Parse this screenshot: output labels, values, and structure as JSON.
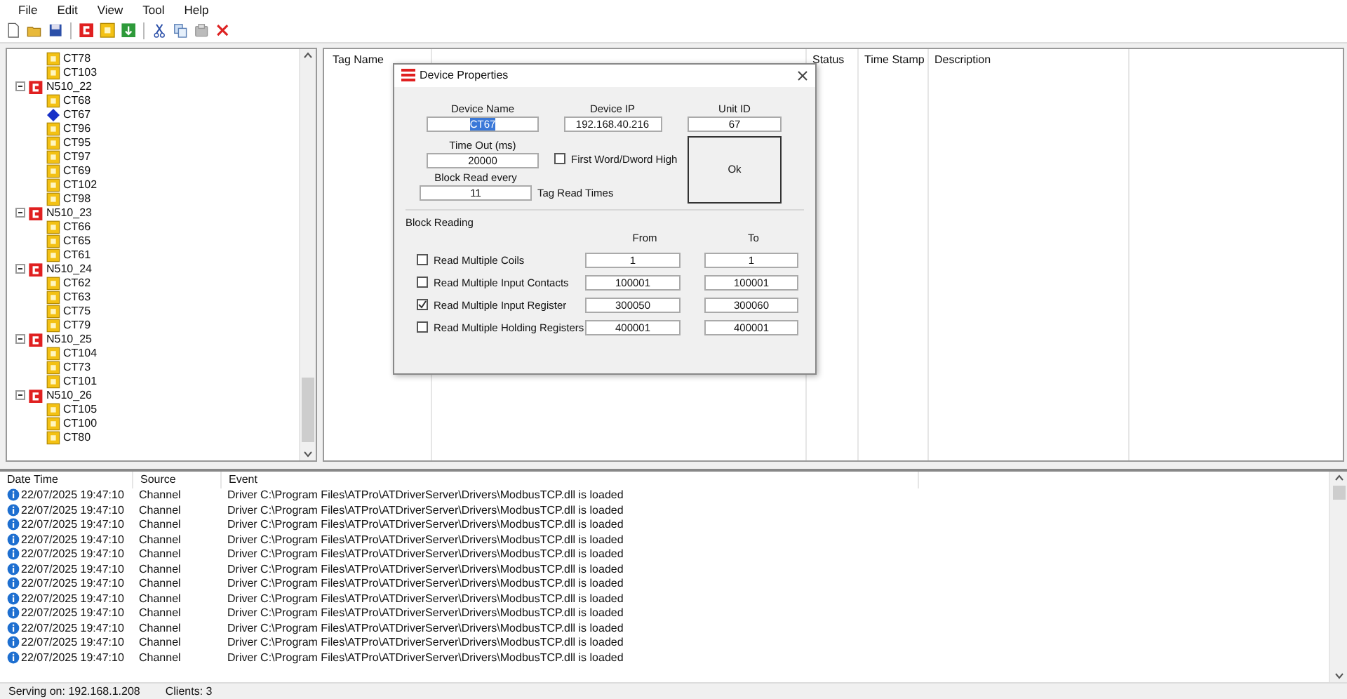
{
  "menu": [
    "File",
    "Edit",
    "View",
    "Tool",
    "Help"
  ],
  "toolbar": [
    {
      "kind": "new"
    },
    {
      "kind": "open"
    },
    {
      "kind": "save"
    },
    {
      "kind": "sep"
    },
    {
      "kind": "device"
    },
    {
      "kind": "tag"
    },
    {
      "kind": "tagdown"
    },
    {
      "kind": "sep"
    },
    {
      "kind": "cut"
    },
    {
      "kind": "copy"
    },
    {
      "kind": "paste"
    },
    {
      "kind": "delete"
    }
  ],
  "tree": [
    {
      "kind": "device",
      "expanded": true,
      "children": [
        {
          "kind": "tag",
          "label": "CT78"
        },
        {
          "kind": "tag",
          "label": "CT103"
        }
      ]
    },
    {
      "kind": "device",
      "label": "N510_22",
      "expanded": true,
      "children": [
        {
          "kind": "tag",
          "label": "CT68"
        },
        {
          "kind": "marker",
          "label": "CT67"
        },
        {
          "kind": "tag",
          "label": "CT96"
        },
        {
          "kind": "tag",
          "label": "CT95"
        },
        {
          "kind": "tag",
          "label": "CT97"
        },
        {
          "kind": "tag",
          "label": "CT69"
        },
        {
          "kind": "tag",
          "label": "CT102"
        },
        {
          "kind": "tag",
          "label": "CT98"
        }
      ]
    },
    {
      "kind": "device",
      "label": "N510_23",
      "expanded": true,
      "children": [
        {
          "kind": "tag",
          "label": "CT66"
        },
        {
          "kind": "tag",
          "label": "CT65"
        },
        {
          "kind": "tag",
          "label": "CT61"
        }
      ]
    },
    {
      "kind": "device",
      "label": "N510_24",
      "expanded": true,
      "children": [
        {
          "kind": "tag",
          "label": "CT62"
        },
        {
          "kind": "tag",
          "label": "CT63"
        },
        {
          "kind": "tag",
          "label": "CT75"
        },
        {
          "kind": "tag",
          "label": "CT79"
        }
      ]
    },
    {
      "kind": "device",
      "label": "N510_25",
      "expanded": true,
      "children": [
        {
          "kind": "tag",
          "label": "CT104"
        },
        {
          "kind": "tag",
          "label": "CT73"
        },
        {
          "kind": "tag",
          "label": "CT101"
        }
      ]
    },
    {
      "kind": "device",
      "label": "N510_26",
      "expanded": true,
      "children": [
        {
          "kind": "tag",
          "label": "CT105"
        },
        {
          "kind": "tag",
          "label": "CT100"
        },
        {
          "kind": "tag",
          "label": "CT80"
        }
      ]
    }
  ],
  "table": {
    "columns": [
      {
        "label": "Tag Name"
      },
      {
        "label": "Status"
      },
      {
        "label": "Time Stamp"
      },
      {
        "label": "Description"
      }
    ]
  },
  "dialog": {
    "title": "Device Properties",
    "device_name": {
      "label": "Device Name",
      "value": "CT67",
      "text_selected": true
    },
    "device_ip": {
      "label": "Device IP",
      "value": "192.168.40.216"
    },
    "unit_id": {
      "label": "Unit ID",
      "value": "67"
    },
    "timeout": {
      "label": "Time Out (ms)",
      "value": "20000"
    },
    "first_word_high": {
      "label": "First Word/Dword High",
      "checked": false
    },
    "ok_button": "Ok",
    "block_read": {
      "label": "Block Read every",
      "value": "11",
      "suffix": "Tag Read Times"
    },
    "block_reading": {
      "title": "Block Reading",
      "from_label": "From",
      "to_label": "To",
      "rows": [
        {
          "label": "Read Multiple Coils",
          "checked": false,
          "from": "1",
          "to": "1"
        },
        {
          "label": "Read Multiple Input Contacts",
          "checked": false,
          "from": "100001",
          "to": "100001"
        },
        {
          "label": "Read Multiple Input Register",
          "checked": true,
          "from": "300050",
          "to": "300060"
        },
        {
          "label": "Read Multiple Holding Registers",
          "checked": false,
          "from": "400001",
          "to": "400001"
        }
      ]
    }
  },
  "log": {
    "columns": [
      "Date Time",
      "Source",
      "Event"
    ],
    "rows": [
      {
        "time": "22/07/2025 19:47:10",
        "source": "Channel",
        "event": "Driver C:\\Program Files\\ATPro\\ATDriverServer\\Drivers\\ModbusTCP.dll is loaded"
      },
      {
        "time": "22/07/2025 19:47:10",
        "source": "Channel",
        "event": "Driver C:\\Program Files\\ATPro\\ATDriverServer\\Drivers\\ModbusTCP.dll is loaded"
      },
      {
        "time": "22/07/2025 19:47:10",
        "source": "Channel",
        "event": "Driver C:\\Program Files\\ATPro\\ATDriverServer\\Drivers\\ModbusTCP.dll is loaded"
      },
      {
        "time": "22/07/2025 19:47:10",
        "source": "Channel",
        "event": "Driver C:\\Program Files\\ATPro\\ATDriverServer\\Drivers\\ModbusTCP.dll is loaded"
      },
      {
        "time": "22/07/2025 19:47:10",
        "source": "Channel",
        "event": "Driver C:\\Program Files\\ATPro\\ATDriverServer\\Drivers\\ModbusTCP.dll is loaded"
      },
      {
        "time": "22/07/2025 19:47:10",
        "source": "Channel",
        "event": "Driver C:\\Program Files\\ATPro\\ATDriverServer\\Drivers\\ModbusTCP.dll is loaded"
      },
      {
        "time": "22/07/2025 19:47:10",
        "source": "Channel",
        "event": "Driver C:\\Program Files\\ATPro\\ATDriverServer\\Drivers\\ModbusTCP.dll is loaded"
      },
      {
        "time": "22/07/2025 19:47:10",
        "source": "Channel",
        "event": "Driver C:\\Program Files\\ATPro\\ATDriverServer\\Drivers\\ModbusTCP.dll is loaded"
      },
      {
        "time": "22/07/2025 19:47:10",
        "source": "Channel",
        "event": "Driver C:\\Program Files\\ATPro\\ATDriverServer\\Drivers\\ModbusTCP.dll is loaded"
      },
      {
        "time": "22/07/2025 19:47:10",
        "source": "Channel",
        "event": "Driver C:\\Program Files\\ATPro\\ATDriverServer\\Drivers\\ModbusTCP.dll is loaded"
      },
      {
        "time": "22/07/2025 19:47:10",
        "source": "Channel",
        "event": "Driver C:\\Program Files\\ATPro\\ATDriverServer\\Drivers\\ModbusTCP.dll is loaded"
      },
      {
        "time": "22/07/2025 19:47:10",
        "source": "Channel",
        "event": "Driver C:\\Program Files\\ATPro\\ATDriverServer\\Drivers\\ModbusTCP.dll is loaded"
      }
    ]
  },
  "status_bar": {
    "serving": "Serving on: 192.168.1.208",
    "clients": "Clients: 3"
  }
}
